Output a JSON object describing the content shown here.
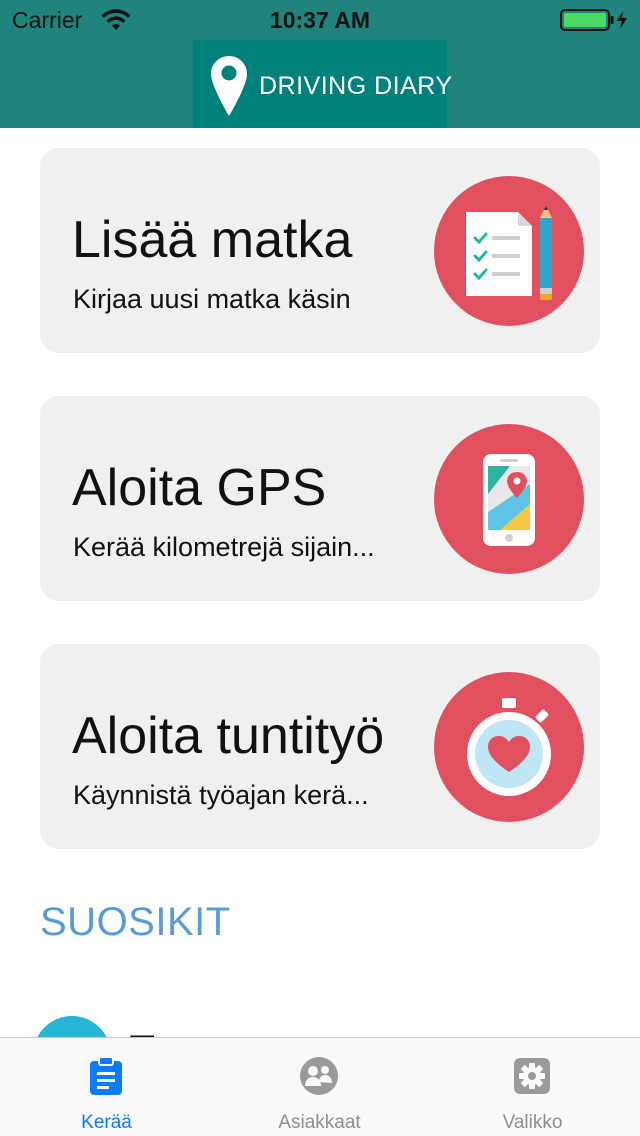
{
  "status_bar": {
    "carrier": "Carrier",
    "time": "10:37 AM",
    "wifi_icon": "wifi-icon",
    "battery_icon": "battery-icon"
  },
  "header": {
    "app_title": "DRIVING DIARY",
    "logo_icon": "map-pin-icon",
    "background_color": "#1f857c",
    "logo_box_color": "#00807a"
  },
  "cards": [
    {
      "title": "Lisää matka",
      "subtitle": "Kirjaa uusi matka käsin",
      "icon": "checklist-pencil-icon"
    },
    {
      "title": "Aloita GPS",
      "subtitle": "Kerää kilometrejä sijain...",
      "icon": "phone-map-icon"
    },
    {
      "title": "Aloita tuntityö",
      "subtitle": "Käynnistä työajan kerä...",
      "icon": "stopwatch-heart-icon"
    }
  ],
  "favorites": {
    "section_title": "SUOSIKIT",
    "items": [
      {
        "label": "T...",
        "avatar_color": "#27b5d6"
      }
    ]
  },
  "tabs": [
    {
      "label": "Kerää",
      "icon": "clipboard-icon",
      "active": true
    },
    {
      "label": "Asiakkaat",
      "icon": "customers-icon",
      "active": false
    },
    {
      "label": "Valikko",
      "icon": "settings-gear-icon",
      "active": false
    }
  ],
  "colors": {
    "accent_red": "#e0505f",
    "tab_active": "#0a7cff",
    "tab_inactive": "#8e8e8e",
    "section_title": "#5a9bd5",
    "battery_green": "#4cd964"
  }
}
